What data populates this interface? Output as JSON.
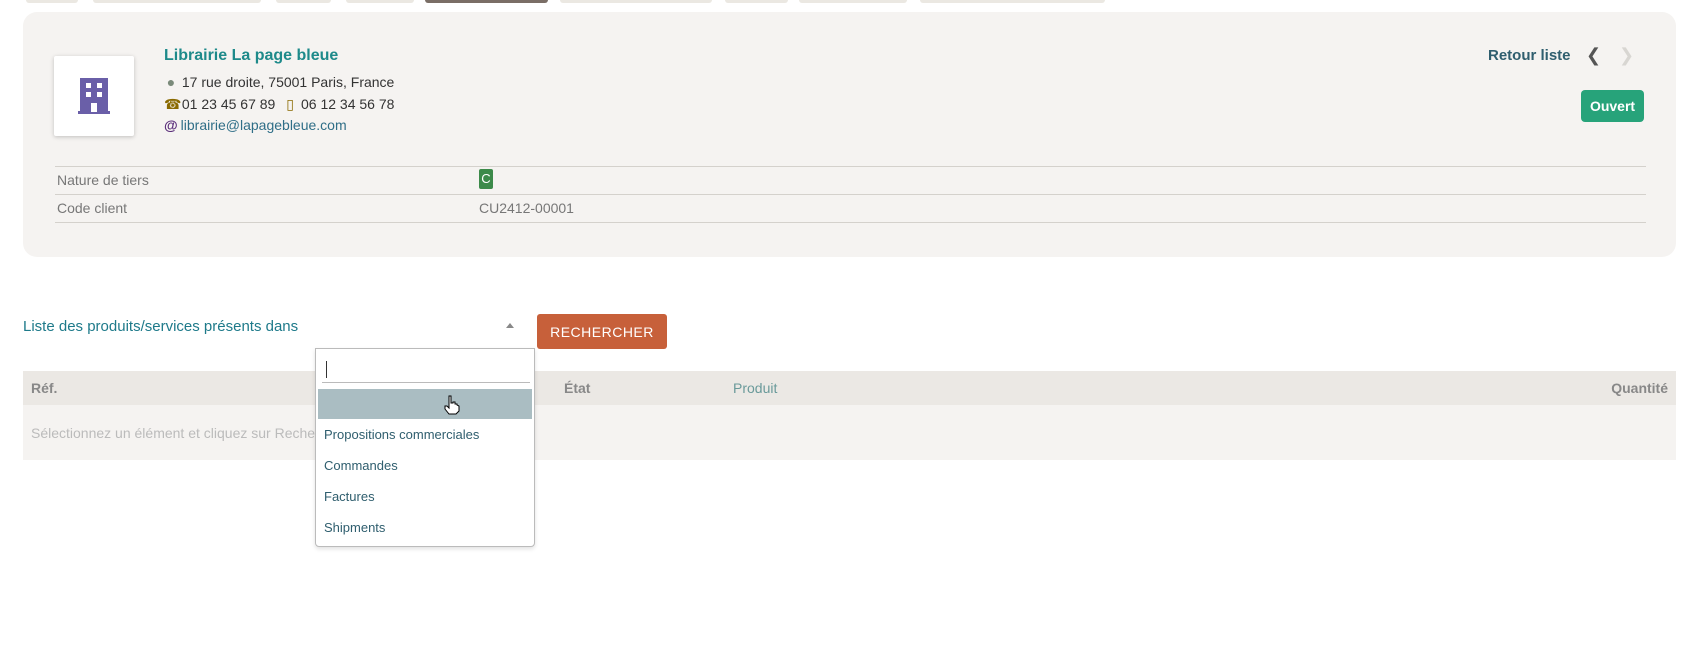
{
  "company": {
    "name": "Librairie La page bleue",
    "address": "17 rue droite, 75001 Paris, France",
    "phone": "01 23 45 67 89",
    "mobile": "06 12 34 56 78",
    "email": "librairie@lapagebleue.com",
    "logo_icon": "building-icon"
  },
  "nav": {
    "back_label": "Retour liste",
    "prev_icon": "chevron-left-icon",
    "next_icon": "chevron-right-icon"
  },
  "status": {
    "label": "Ouvert",
    "color": "#27a37a"
  },
  "fields": [
    {
      "label": "Nature de tiers",
      "value": "C"
    },
    {
      "label": "Code client",
      "value": "CU2412-00001"
    }
  ],
  "search": {
    "select_label": "Liste des produits/services présents dans",
    "button_label": "RECHERCHER",
    "dropdown_query": "",
    "options": [
      "",
      "Propositions commerciales",
      "Commandes",
      "Factures",
      "Shipments"
    ]
  },
  "results": {
    "columns": [
      "Réf.",
      "État",
      "Produit",
      "Quantité"
    ],
    "empty_message": "Sélectionnez un élément et cliquez sur Rechercher"
  },
  "colors": {
    "accent_teal": "#1e8a8a",
    "button_orange": "#c7603a",
    "highlight": "#aabdc2"
  }
}
